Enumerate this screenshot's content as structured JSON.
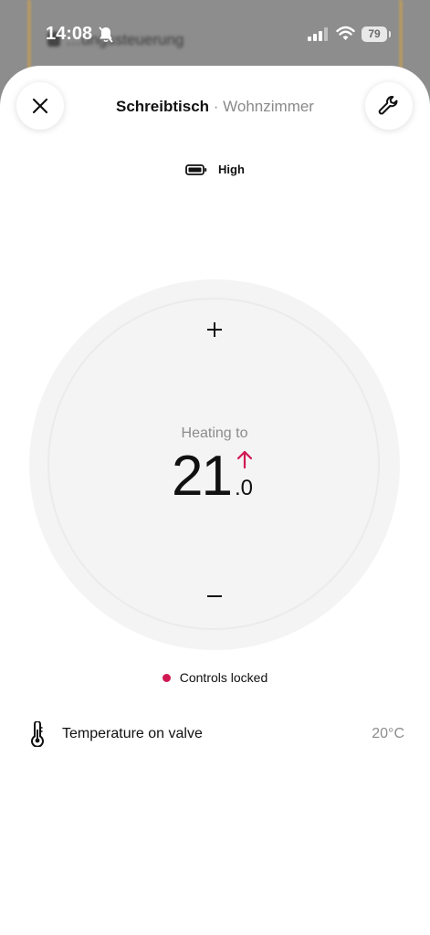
{
  "status_bar": {
    "time": "14:08",
    "battery": "79"
  },
  "background_app": {
    "title": "…ungssteuerung"
  },
  "header": {
    "device_name": "Schreibtisch",
    "separator": " · ",
    "room_name": "Wohnzimmer"
  },
  "battery_level": {
    "label": "High",
    "icon": "battery-full-icon"
  },
  "thermostat": {
    "mode_label": "Heating to",
    "temp_whole": "21",
    "temp_decimal": ".0",
    "plus_symbol": "+",
    "minus_symbol": "−",
    "accent_color": "#d01852"
  },
  "lock_status": {
    "label": "Controls locked"
  },
  "valve": {
    "label": "Temperature on valve",
    "value": "20°C",
    "icon": "thermometer-icon"
  }
}
